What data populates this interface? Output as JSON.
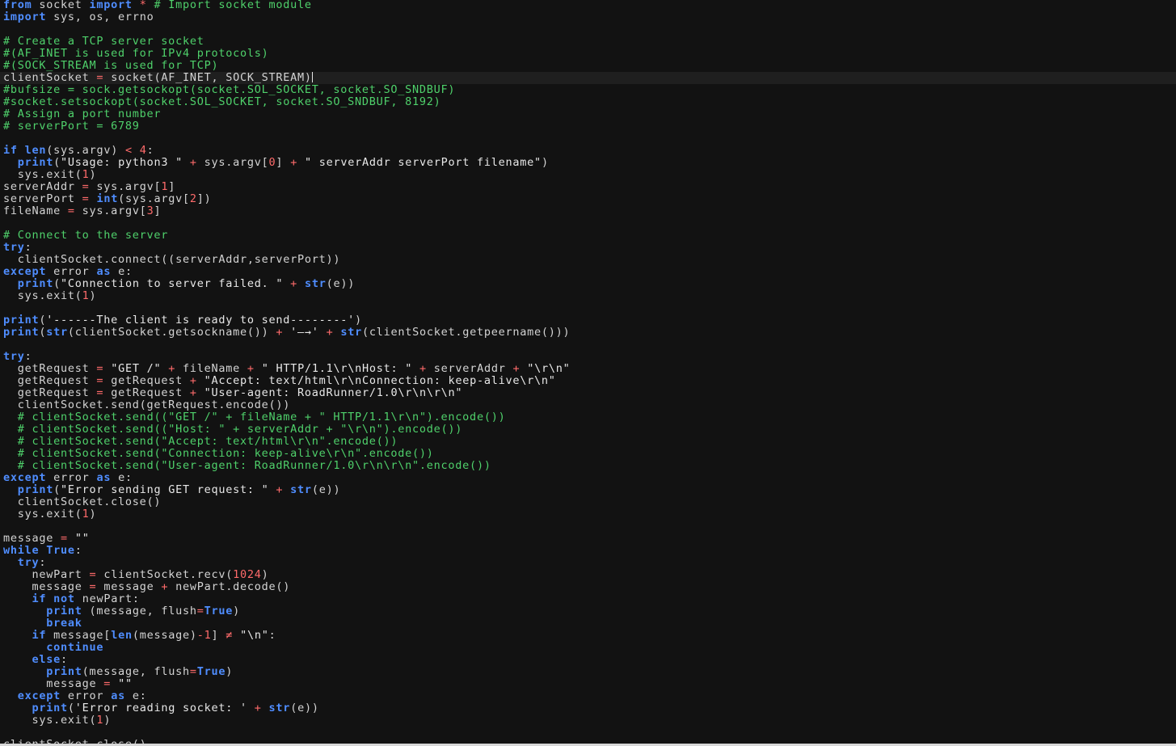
{
  "editor": {
    "language": "python",
    "current_line": 6,
    "colors": {
      "background": "#121212",
      "current_line": "#1f1f1f",
      "keyword": "#4f8dff",
      "comment": "#4fd16b",
      "string": "#e8e8e8",
      "number": "#ff6b6b",
      "operator": "#ff6b6b",
      "plain": "#d4d4d4"
    },
    "lines": [
      [
        [
          "kw",
          "from"
        ],
        [
          "pl",
          " socket "
        ],
        [
          "kw",
          "import"
        ],
        [
          "pl",
          " "
        ],
        [
          "op",
          "*"
        ],
        [
          "pl",
          " "
        ],
        [
          "cm",
          "# Import socket module"
        ]
      ],
      [
        [
          "kw",
          "import"
        ],
        [
          "pl",
          " sys, os, errno"
        ]
      ],
      [],
      [
        [
          "cm",
          "# Create a TCP server socket"
        ]
      ],
      [
        [
          "cm",
          "#(AF_INET is used for IPv4 protocols)"
        ]
      ],
      [
        [
          "cm",
          "#(SOCK_STREAM is used for TCP)"
        ]
      ],
      [
        [
          "pl",
          "clientSocket "
        ],
        [
          "op",
          "="
        ],
        [
          "pl",
          " socket(AF_INET, SOCK_STREAM)"
        ]
      ],
      [
        [
          "cm",
          "#bufsize = sock.getsockopt(socket.SOL_SOCKET, socket.SO_SNDBUF)"
        ]
      ],
      [
        [
          "cm",
          "#socket.setsockopt(socket.SOL_SOCKET, socket.SO_SNDBUF, 8192)"
        ]
      ],
      [
        [
          "cm",
          "# Assign a port number"
        ]
      ],
      [
        [
          "cm",
          "# serverPort = 6789"
        ]
      ],
      [],
      [
        [
          "kw",
          "if"
        ],
        [
          "pl",
          " "
        ],
        [
          "kw",
          "len"
        ],
        [
          "pl",
          "(sys.argv) "
        ],
        [
          "op",
          "<"
        ],
        [
          "pl",
          " "
        ],
        [
          "nu",
          "4"
        ],
        [
          "pl",
          ":"
        ]
      ],
      [
        [
          "pl",
          "  "
        ],
        [
          "kw",
          "print"
        ],
        [
          "pl",
          "("
        ],
        [
          "st",
          "\"Usage: python3 \""
        ],
        [
          "pl",
          " "
        ],
        [
          "op",
          "+"
        ],
        [
          "pl",
          " sys.argv["
        ],
        [
          "nu",
          "0"
        ],
        [
          "pl",
          "] "
        ],
        [
          "op",
          "+"
        ],
        [
          "pl",
          " "
        ],
        [
          "st",
          "\" serverAddr serverPort filename\""
        ],
        [
          "pl",
          ")"
        ]
      ],
      [
        [
          "pl",
          "  sys.exit("
        ],
        [
          "nu",
          "1"
        ],
        [
          "pl",
          ")"
        ]
      ],
      [
        [
          "pl",
          "serverAddr "
        ],
        [
          "op",
          "="
        ],
        [
          "pl",
          " sys.argv["
        ],
        [
          "nu",
          "1"
        ],
        [
          "pl",
          "]"
        ]
      ],
      [
        [
          "pl",
          "serverPort "
        ],
        [
          "op",
          "="
        ],
        [
          "pl",
          " "
        ],
        [
          "kw",
          "int"
        ],
        [
          "pl",
          "(sys.argv["
        ],
        [
          "nu",
          "2"
        ],
        [
          "pl",
          "])"
        ]
      ],
      [
        [
          "pl",
          "fileName "
        ],
        [
          "op",
          "="
        ],
        [
          "pl",
          " sys.argv["
        ],
        [
          "nu",
          "3"
        ],
        [
          "pl",
          "]"
        ]
      ],
      [],
      [
        [
          "cm",
          "# Connect to the server"
        ]
      ],
      [
        [
          "kw",
          "try"
        ],
        [
          "pl",
          ":"
        ]
      ],
      [
        [
          "pl",
          "  clientSocket.connect((serverAddr,serverPort))"
        ]
      ],
      [
        [
          "kw",
          "except"
        ],
        [
          "pl",
          " error "
        ],
        [
          "kw",
          "as"
        ],
        [
          "pl",
          " e:"
        ]
      ],
      [
        [
          "pl",
          "  "
        ],
        [
          "kw",
          "print"
        ],
        [
          "pl",
          "("
        ],
        [
          "st",
          "\"Connection to server failed. \""
        ],
        [
          "pl",
          " "
        ],
        [
          "op",
          "+"
        ],
        [
          "pl",
          " "
        ],
        [
          "kw",
          "str"
        ],
        [
          "pl",
          "(e))"
        ]
      ],
      [
        [
          "pl",
          "  sys.exit("
        ],
        [
          "nu",
          "1"
        ],
        [
          "pl",
          ")"
        ]
      ],
      [],
      [
        [
          "kw",
          "print"
        ],
        [
          "pl",
          "("
        ],
        [
          "st",
          "'------The client is ready to send--------'"
        ],
        [
          "pl",
          ")"
        ]
      ],
      [
        [
          "kw",
          "print"
        ],
        [
          "pl",
          "("
        ],
        [
          "kw",
          "str"
        ],
        [
          "pl",
          "(clientSocket.getsockname()) "
        ],
        [
          "op",
          "+"
        ],
        [
          "pl",
          " "
        ],
        [
          "st",
          "'—→'"
        ],
        [
          "pl",
          " "
        ],
        [
          "op",
          "+"
        ],
        [
          "pl",
          " "
        ],
        [
          "kw",
          "str"
        ],
        [
          "pl",
          "(clientSocket.getpeername()))"
        ]
      ],
      [],
      [
        [
          "kw",
          "try"
        ],
        [
          "pl",
          ":"
        ]
      ],
      [
        [
          "pl",
          "  getRequest "
        ],
        [
          "op",
          "="
        ],
        [
          "pl",
          " "
        ],
        [
          "st",
          "\"GET /\""
        ],
        [
          "pl",
          " "
        ],
        [
          "op",
          "+"
        ],
        [
          "pl",
          " fileName "
        ],
        [
          "op",
          "+"
        ],
        [
          "pl",
          " "
        ],
        [
          "st",
          "\" HTTP/1.1\\r\\nHost: \""
        ],
        [
          "pl",
          " "
        ],
        [
          "op",
          "+"
        ],
        [
          "pl",
          " serverAddr "
        ],
        [
          "op",
          "+"
        ],
        [
          "pl",
          " "
        ],
        [
          "st",
          "\"\\r\\n\""
        ]
      ],
      [
        [
          "pl",
          "  getRequest "
        ],
        [
          "op",
          "="
        ],
        [
          "pl",
          " getRequest "
        ],
        [
          "op",
          "+"
        ],
        [
          "pl",
          " "
        ],
        [
          "st",
          "\"Accept: text/html\\r\\nConnection: keep-alive\\r\\n\""
        ]
      ],
      [
        [
          "pl",
          "  getRequest "
        ],
        [
          "op",
          "="
        ],
        [
          "pl",
          " getRequest "
        ],
        [
          "op",
          "+"
        ],
        [
          "pl",
          " "
        ],
        [
          "st",
          "\"User-agent: RoadRunner/1.0\\r\\n\\r\\n\""
        ]
      ],
      [
        [
          "pl",
          "  clientSocket.send(getRequest.encode())"
        ]
      ],
      [
        [
          "pl",
          "  "
        ],
        [
          "cm",
          "# clientSocket.send((\"GET /\" + fileName + \" HTTP/1.1\\r\\n\").encode())"
        ]
      ],
      [
        [
          "pl",
          "  "
        ],
        [
          "cm",
          "# clientSocket.send((\"Host: \" + serverAddr + \"\\r\\n\").encode())"
        ]
      ],
      [
        [
          "pl",
          "  "
        ],
        [
          "cm",
          "# clientSocket.send(\"Accept: text/html\\r\\n\".encode())"
        ]
      ],
      [
        [
          "pl",
          "  "
        ],
        [
          "cm",
          "# clientSocket.send(\"Connection: keep-alive\\r\\n\".encode())"
        ]
      ],
      [
        [
          "pl",
          "  "
        ],
        [
          "cm",
          "# clientSocket.send(\"User-agent: RoadRunner/1.0\\r\\n\\r\\n\".encode())"
        ]
      ],
      [
        [
          "kw",
          "except"
        ],
        [
          "pl",
          " error "
        ],
        [
          "kw",
          "as"
        ],
        [
          "pl",
          " e:"
        ]
      ],
      [
        [
          "pl",
          "  "
        ],
        [
          "kw",
          "print"
        ],
        [
          "pl",
          "("
        ],
        [
          "st",
          "\"Error sending GET request: \""
        ],
        [
          "pl",
          " "
        ],
        [
          "op",
          "+"
        ],
        [
          "pl",
          " "
        ],
        [
          "kw",
          "str"
        ],
        [
          "pl",
          "(e))"
        ]
      ],
      [
        [
          "pl",
          "  clientSocket.close()"
        ]
      ],
      [
        [
          "pl",
          "  sys.exit("
        ],
        [
          "nu",
          "1"
        ],
        [
          "pl",
          ")"
        ]
      ],
      [],
      [
        [
          "pl",
          "message "
        ],
        [
          "op",
          "="
        ],
        [
          "pl",
          " "
        ],
        [
          "st",
          "\"\""
        ]
      ],
      [
        [
          "kw",
          "while"
        ],
        [
          "pl",
          " "
        ],
        [
          "kw",
          "True"
        ],
        [
          "pl",
          ":"
        ]
      ],
      [
        [
          "pl",
          "  "
        ],
        [
          "kw",
          "try"
        ],
        [
          "pl",
          ":"
        ]
      ],
      [
        [
          "pl",
          "    newPart "
        ],
        [
          "op",
          "="
        ],
        [
          "pl",
          " clientSocket.recv("
        ],
        [
          "nu",
          "1024"
        ],
        [
          "pl",
          ")"
        ]
      ],
      [
        [
          "pl",
          "    message "
        ],
        [
          "op",
          "="
        ],
        [
          "pl",
          " message "
        ],
        [
          "op",
          "+"
        ],
        [
          "pl",
          " newPart.decode()"
        ]
      ],
      [
        [
          "pl",
          "    "
        ],
        [
          "kw",
          "if"
        ],
        [
          "pl",
          " "
        ],
        [
          "kw",
          "not"
        ],
        [
          "pl",
          " newPart:"
        ]
      ],
      [
        [
          "pl",
          "      "
        ],
        [
          "kw",
          "print"
        ],
        [
          "pl",
          " (message, flush"
        ],
        [
          "op",
          "="
        ],
        [
          "kw",
          "True"
        ],
        [
          "pl",
          ")"
        ]
      ],
      [
        [
          "pl",
          "      "
        ],
        [
          "kw",
          "break"
        ]
      ],
      [
        [
          "pl",
          "    "
        ],
        [
          "kw",
          "if"
        ],
        [
          "pl",
          " message["
        ],
        [
          "kw",
          "len"
        ],
        [
          "pl",
          "(message)"
        ],
        [
          "op",
          "-"
        ],
        [
          "nu",
          "1"
        ],
        [
          "pl",
          "] "
        ],
        [
          "op",
          "≠"
        ],
        [
          "pl",
          " "
        ],
        [
          "st",
          "\"\\n\""
        ],
        [
          "pl",
          ":"
        ]
      ],
      [
        [
          "pl",
          "      "
        ],
        [
          "kw",
          "continue"
        ]
      ],
      [
        [
          "pl",
          "    "
        ],
        [
          "kw",
          "else"
        ],
        [
          "pl",
          ":"
        ]
      ],
      [
        [
          "pl",
          "      "
        ],
        [
          "kw",
          "print"
        ],
        [
          "pl",
          "(message, flush"
        ],
        [
          "op",
          "="
        ],
        [
          "kw",
          "True"
        ],
        [
          "pl",
          ")"
        ]
      ],
      [
        [
          "pl",
          "      message "
        ],
        [
          "op",
          "="
        ],
        [
          "pl",
          " "
        ],
        [
          "st",
          "\"\""
        ]
      ],
      [
        [
          "pl",
          "  "
        ],
        [
          "kw",
          "except"
        ],
        [
          "pl",
          " error "
        ],
        [
          "kw",
          "as"
        ],
        [
          "pl",
          " e:"
        ]
      ],
      [
        [
          "pl",
          "    "
        ],
        [
          "kw",
          "print"
        ],
        [
          "pl",
          "("
        ],
        [
          "st",
          "'Error reading socket: '"
        ],
        [
          "pl",
          " "
        ],
        [
          "op",
          "+"
        ],
        [
          "pl",
          " "
        ],
        [
          "kw",
          "str"
        ],
        [
          "pl",
          "(e))"
        ]
      ],
      [
        [
          "pl",
          "    sys.exit("
        ],
        [
          "nu",
          "1"
        ],
        [
          "pl",
          ")"
        ]
      ],
      [],
      [
        [
          "pl",
          "clientSocket.close()"
        ]
      ]
    ]
  }
}
